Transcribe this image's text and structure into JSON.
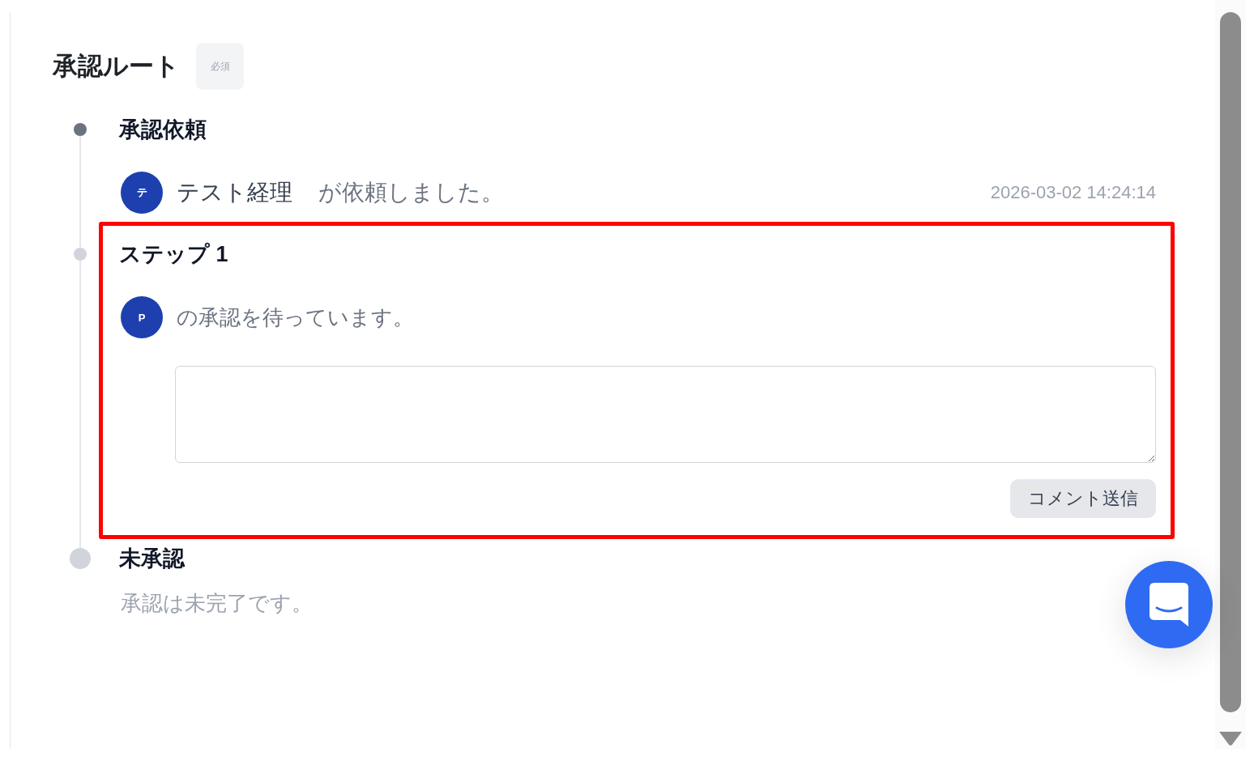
{
  "section": {
    "title": "承認ルート",
    "badge": "必須"
  },
  "timeline": [
    {
      "kind": "request",
      "label": "承認依頼",
      "done": true,
      "highlighted": false,
      "entries": [
        {
          "avatar": "テ",
          "name": "テスト経理",
          "message": "が依頼しました。",
          "timestamp": "2026-03-02 14:24:14"
        }
      ]
    },
    {
      "kind": "step",
      "label": "ステップ 1",
      "done": false,
      "highlighted": true,
      "entries": [
        {
          "avatar": "P",
          "message": "の承認を待っています。"
        }
      ],
      "comment_button": "コメント送信"
    },
    {
      "kind": "result",
      "label": "未承認",
      "done": false,
      "highlighted": false,
      "note": "承認は未完了です。"
    }
  ]
}
